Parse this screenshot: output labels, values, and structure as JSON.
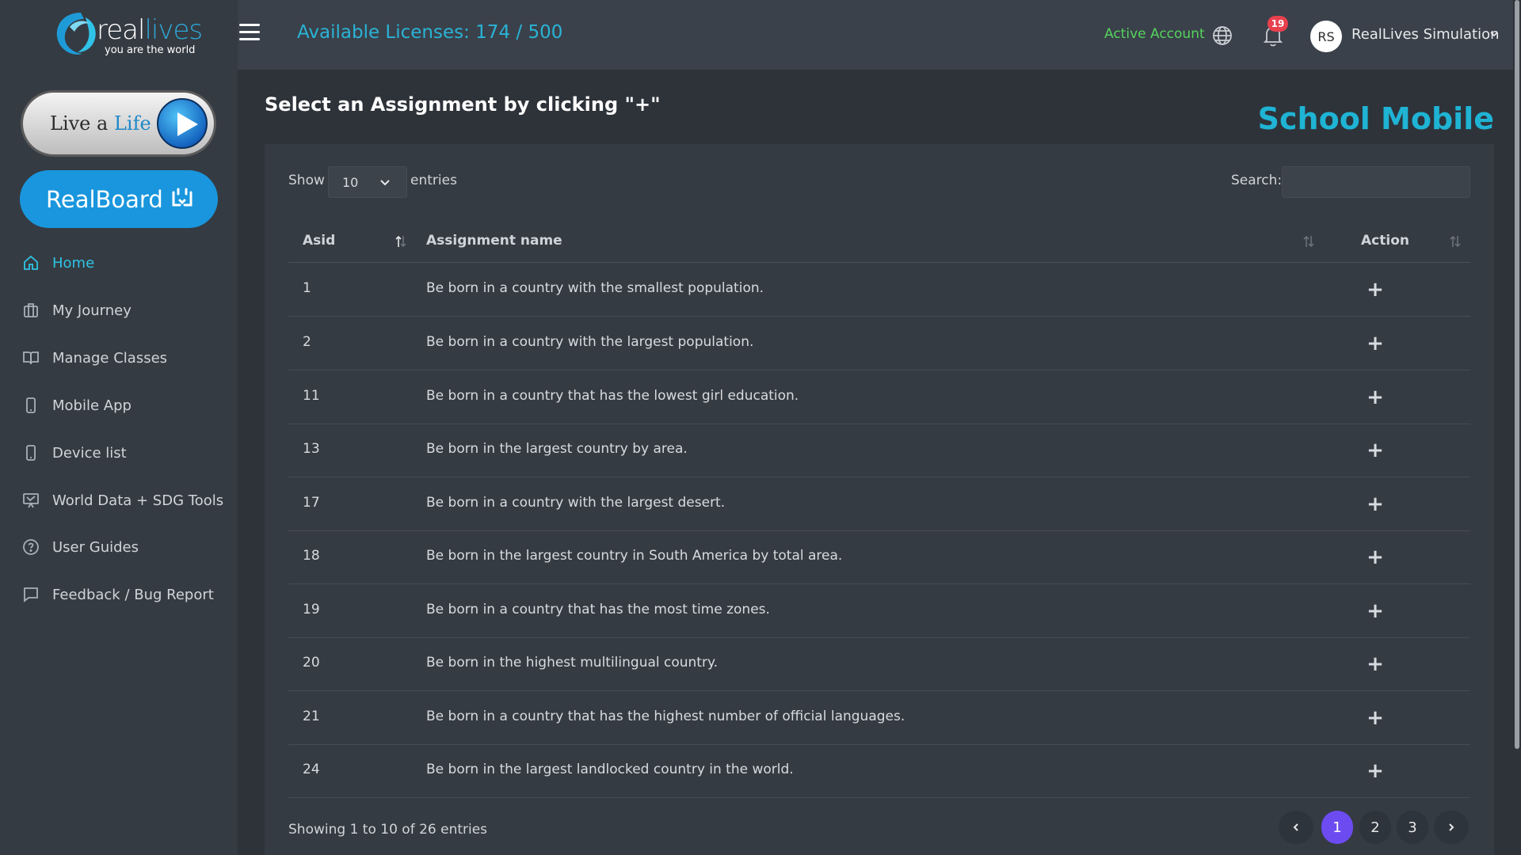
{
  "brand": {
    "name_real": "real",
    "name_lives": "lives",
    "tagline": "you are the world"
  },
  "sidebar": {
    "live_button": {
      "label_prefix": "Live a ",
      "label_highlight": "Life"
    },
    "realboard_button": {
      "label": "RealBoard"
    },
    "items": [
      {
        "label": "Home",
        "icon": "home-icon",
        "active": true
      },
      {
        "label": "My Journey",
        "icon": "briefcase-icon",
        "active": false
      },
      {
        "label": "Manage Classes",
        "icon": "book-icon",
        "active": false
      },
      {
        "label": "Mobile App",
        "icon": "mobile-icon",
        "active": false
      },
      {
        "label": "Device list",
        "icon": "device-icon",
        "active": false
      },
      {
        "label": "World Data + SDG Tools",
        "icon": "presentation-icon",
        "active": false
      },
      {
        "label": "User Guides",
        "icon": "help-circle-icon",
        "active": false
      },
      {
        "label": "Feedback / Bug Report",
        "icon": "message-icon",
        "active": false
      }
    ]
  },
  "header": {
    "licenses": "Available Licenses: 174 / 500",
    "status": "Active Account",
    "notifications_count": "19",
    "avatar_initials": "RS",
    "user_name": "RealLives Simulation"
  },
  "main": {
    "heading": "Select an Assignment by clicking \"+\"",
    "school_name": "School Mobile",
    "table": {
      "show_label": "Show",
      "page_size": "10",
      "entries_label": "entries",
      "search_label": "Search:",
      "search_value": "",
      "columns": [
        "Asid",
        "Assignment name",
        "Action"
      ],
      "rows": [
        {
          "asid": "1",
          "name": "Be born in a country with the smallest population.",
          "action": "+"
        },
        {
          "asid": "2",
          "name": "Be born in a country with the largest population.",
          "action": "+"
        },
        {
          "asid": "11",
          "name": "Be born in a country that has the lowest girl education.",
          "action": "+"
        },
        {
          "asid": "13",
          "name": "Be born in the largest country by area.",
          "action": "+"
        },
        {
          "asid": "17",
          "name": "Be born in a country with the largest desert.",
          "action": "+"
        },
        {
          "asid": "18",
          "name": "Be born in the largest country in South America by total area.",
          "action": "+"
        },
        {
          "asid": "19",
          "name": "Be born in a country that has the most time zones.",
          "action": "+"
        },
        {
          "asid": "20",
          "name": "Be born in the highest multilingual country.",
          "action": "+"
        },
        {
          "asid": "21",
          "name": "Be born in a country that has the highest number of official languages.",
          "action": "+"
        },
        {
          "asid": "24",
          "name": "Be born in the largest landlocked country in the world.",
          "action": "+"
        }
      ],
      "info": "Showing 1 to 10 of 26 entries",
      "pages": [
        "1",
        "2",
        "3"
      ],
      "current_page": "1"
    }
  },
  "colors": {
    "accent": "#1fb3d4",
    "active_green": "#55d35d",
    "badge_red": "#e8414d",
    "page_active": "#6c4cf1",
    "button_blue": "#1996dd"
  }
}
